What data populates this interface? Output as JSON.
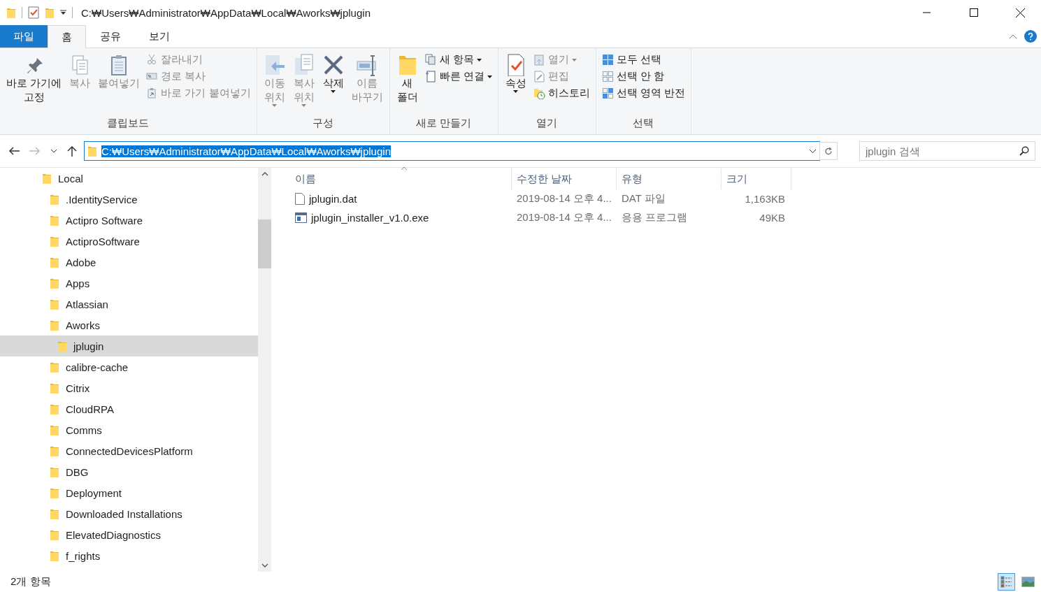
{
  "window": {
    "title": "C:₩Users₩Administrator₩AppData₩Local₩Aworks₩jplugin"
  },
  "ribbon_tabs": [
    {
      "label": "파일",
      "kind": "file",
      "selected": false
    },
    {
      "label": "홈",
      "kind": "tab",
      "selected": true
    },
    {
      "label": "공유",
      "kind": "tab",
      "selected": false
    },
    {
      "label": "보기",
      "kind": "tab",
      "selected": false
    }
  ],
  "ribbon_groups": [
    {
      "label": "클립보드",
      "items": [
        {
          "kind": "large",
          "label": "바로 가기에\n고정",
          "disabled": false,
          "dropdown": false
        },
        {
          "kind": "large",
          "label": "복사",
          "disabled": true,
          "dropdown": false
        },
        {
          "kind": "large",
          "label": "붙여넣기",
          "disabled": true,
          "dropdown": false
        },
        {
          "kind": "small",
          "label": "잘라내기",
          "disabled": true,
          "dropdown": false
        },
        {
          "kind": "small",
          "label": "경로 복사",
          "disabled": true,
          "dropdown": false
        },
        {
          "kind": "small",
          "label": "바로 가기 붙여넣기",
          "disabled": true,
          "dropdown": false
        }
      ]
    },
    {
      "label": "구성",
      "items": [
        {
          "kind": "large",
          "label": "이동\n위치",
          "disabled": true,
          "dropdown": true
        },
        {
          "kind": "large",
          "label": "복사\n위치",
          "disabled": true,
          "dropdown": true
        },
        {
          "kind": "large",
          "label": "삭제",
          "disabled": false,
          "dropdown": true
        },
        {
          "kind": "large",
          "label": "이름\n바꾸기",
          "disabled": true,
          "dropdown": false
        }
      ]
    },
    {
      "label": "새로 만들기",
      "items": [
        {
          "kind": "large",
          "label": "새\n폴더",
          "disabled": false,
          "dropdown": false
        },
        {
          "kind": "small",
          "label": "새 항목",
          "disabled": false,
          "dropdown": true
        },
        {
          "kind": "small",
          "label": "빠른 연결",
          "disabled": false,
          "dropdown": true
        }
      ]
    },
    {
      "label": "열기",
      "items": [
        {
          "kind": "large",
          "label": "속성",
          "disabled": false,
          "dropdown": true
        },
        {
          "kind": "small",
          "label": "열기",
          "disabled": true,
          "dropdown": true
        },
        {
          "kind": "small",
          "label": "편집",
          "disabled": true,
          "dropdown": false
        },
        {
          "kind": "small",
          "label": "히스토리",
          "disabled": false,
          "dropdown": false
        }
      ]
    },
    {
      "label": "선택",
      "items": [
        {
          "kind": "small",
          "label": "모두 선택",
          "disabled": false,
          "dropdown": false
        },
        {
          "kind": "small",
          "label": "선택 안 함",
          "disabled": false,
          "dropdown": false
        },
        {
          "kind": "small",
          "label": "선택 영역 반전",
          "disabled": false,
          "dropdown": false
        }
      ]
    }
  ],
  "address": {
    "value": "C:₩Users₩Administrator₩AppData₩Local₩Aworks₩jplugin",
    "selected": true
  },
  "search": {
    "placeholder": "jplugin 검색"
  },
  "tree": [
    {
      "label": "Local",
      "selected": false,
      "children": [
        {
          "label": ".IdentityService",
          "selected": false
        },
        {
          "label": "Actipro Software",
          "selected": false
        },
        {
          "label": "ActiproSoftware",
          "selected": false
        },
        {
          "label": "Adobe",
          "selected": false
        },
        {
          "label": "Apps",
          "selected": false
        },
        {
          "label": "Atlassian",
          "selected": false
        },
        {
          "label": "Aworks",
          "selected": false,
          "children": [
            {
              "label": "jplugin",
              "selected": true
            }
          ]
        },
        {
          "label": "calibre-cache",
          "selected": false
        },
        {
          "label": "Citrix",
          "selected": false
        },
        {
          "label": "CloudRPA",
          "selected": false
        },
        {
          "label": "Comms",
          "selected": false
        },
        {
          "label": "ConnectedDevicesPlatform",
          "selected": false
        },
        {
          "label": "DBG",
          "selected": false
        },
        {
          "label": "Deployment",
          "selected": false
        },
        {
          "label": "Downloaded Installations",
          "selected": false
        },
        {
          "label": "ElevatedDiagnostics",
          "selected": false
        },
        {
          "label": "f_rights",
          "selected": false
        }
      ]
    }
  ],
  "columns": [
    {
      "label": "이름",
      "sorted": true
    },
    {
      "label": "수정한 날짜",
      "sorted": false
    },
    {
      "label": "유형",
      "sorted": false
    },
    {
      "label": "크기",
      "sorted": false
    }
  ],
  "files": [
    {
      "kind": "dat",
      "name": "jplugin.dat",
      "modified": "2019-08-14 오후 4...",
      "type": "DAT 파일",
      "size": "1,163KB"
    },
    {
      "kind": "exe",
      "name": "jplugin_installer_v1.0.exe",
      "modified": "2019-08-14 오후 4...",
      "type": "응용 프로그램",
      "size": "49KB"
    }
  ],
  "status_bar": {
    "count": "2개 항목"
  },
  "view_buttons": [
    {
      "kind": "details",
      "selected": true
    },
    {
      "kind": "large_icons",
      "selected": false
    }
  ]
}
